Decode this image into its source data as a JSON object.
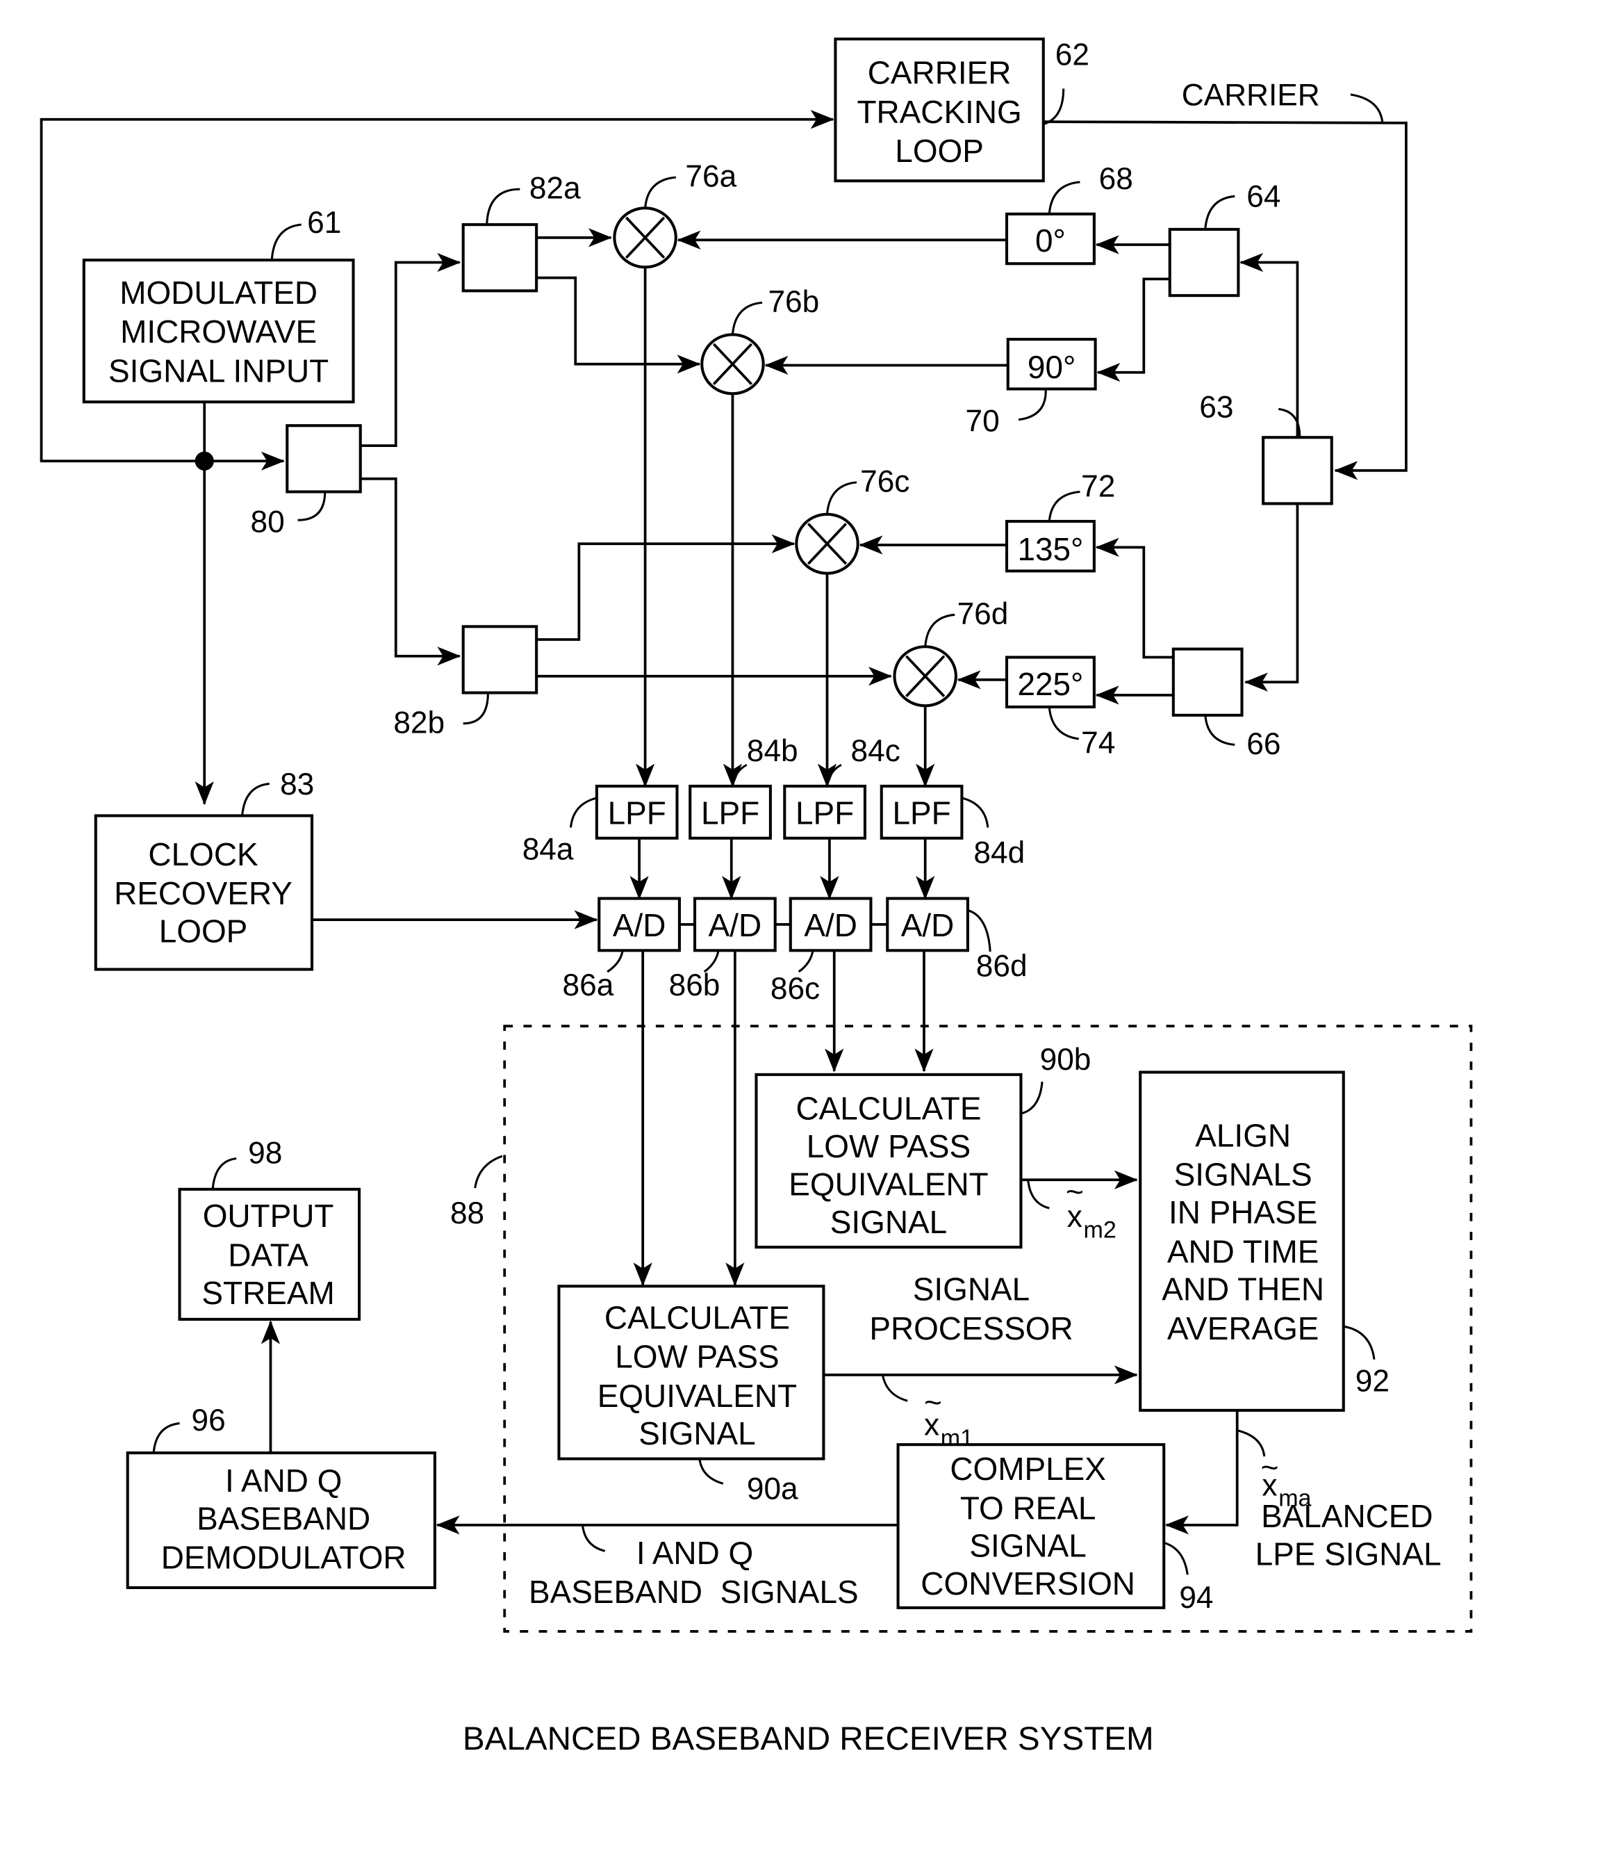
{
  "figure": {
    "caption": "BALANCED BASEBAND RECEIVER SYSTEM"
  },
  "blocks": {
    "carrier_tracking": {
      "ref": "62",
      "lines": [
        "CARRIER",
        "TRACKING",
        "LOOP"
      ]
    },
    "signal_input": {
      "ref": "61",
      "lines": [
        "MODULATED",
        "MICROWAVE",
        "SIGNAL INPUT"
      ]
    },
    "clock_recovery": {
      "ref": "83",
      "lines": [
        "CLOCK",
        "RECOVERY",
        "LOOP"
      ]
    },
    "output_stream": {
      "ref": "98",
      "lines": [
        "OUTPUT",
        "DATA",
        "STREAM"
      ]
    },
    "iq_demod": {
      "ref": "96",
      "lines": [
        "I AND Q",
        "BASEBAND",
        "DEMODULATOR"
      ]
    },
    "calc_lpe_b": {
      "ref": "90b",
      "lines": [
        "CALCULATE",
        "LOW PASS",
        "EQUIVALENT",
        "SIGNAL"
      ]
    },
    "calc_lpe_a": {
      "ref": "90a",
      "lines": [
        "CALCULATE",
        "LOW PASS",
        "EQUIVALENT",
        "SIGNAL"
      ]
    },
    "align": {
      "ref": "92",
      "lines": [
        "ALIGN",
        "SIGNALS",
        "IN PHASE",
        "AND TIME",
        "AND THEN",
        "AVERAGE"
      ]
    },
    "complex_real": {
      "ref": "94",
      "lines": [
        "COMPLEX",
        "TO REAL",
        "SIGNAL",
        "CONVERSION"
      ]
    }
  },
  "splitters": {
    "s80": "80",
    "s82a": "82a",
    "s82b": "82b",
    "s63": "63",
    "s64": "64",
    "s66": "66"
  },
  "phase_shifters": [
    {
      "ref": "68",
      "label": "0°"
    },
    {
      "ref": "70",
      "label": "90°"
    },
    {
      "ref": "72",
      "label": "135°"
    },
    {
      "ref": "74",
      "label": "225°"
    }
  ],
  "mixers": [
    "76a",
    "76b",
    "76c",
    "76d"
  ],
  "lpf": {
    "label": "LPF",
    "refs": [
      "84a",
      "84b",
      "84c",
      "84d"
    ]
  },
  "adc": {
    "label": "A/D",
    "refs": [
      "86a",
      "86b",
      "86c",
      "86d"
    ]
  },
  "signal_processor": {
    "ref": "88",
    "lines": [
      "SIGNAL",
      "PROCESSOR"
    ]
  },
  "signals": {
    "carrier": "CARRIER",
    "x_m1": "x",
    "x_m1_sub": "m1",
    "x_m2": "x",
    "x_m2_sub": "m2",
    "x_ma": "x",
    "x_ma_sub": "ma",
    "balanced_lpe": [
      "BALANCED",
      "LPE SIGNAL"
    ],
    "iq_baseband": [
      "I AND Q",
      "BASEBAND  SIGNALS"
    ],
    "tilde": "~"
  }
}
